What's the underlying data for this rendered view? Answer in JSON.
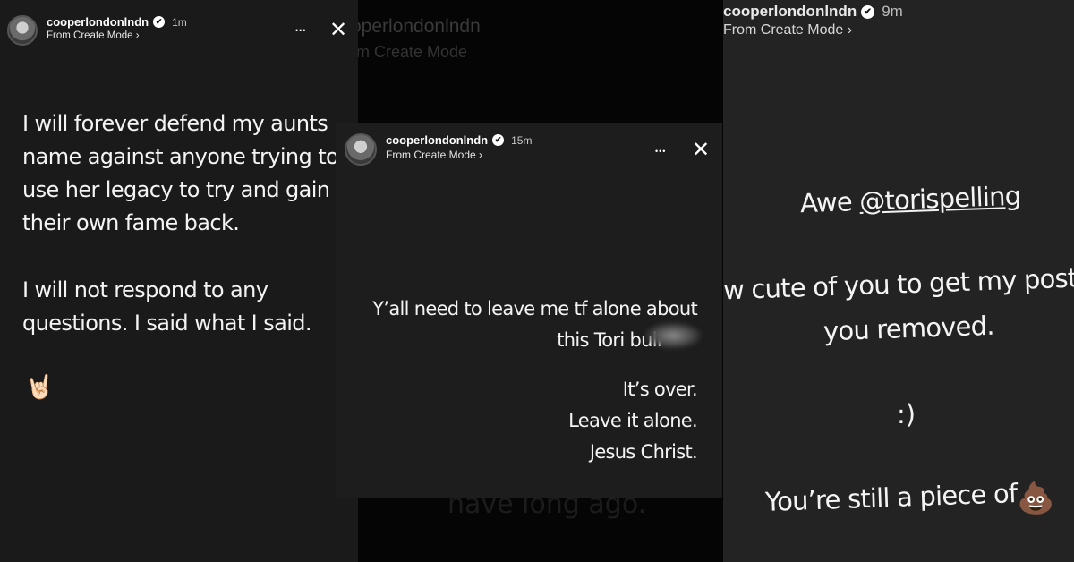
{
  "left_story": {
    "username": "cooperlondonlndn",
    "verified_mark": "✔",
    "time": "1m",
    "subtitle": "From Create Mode ›",
    "more_icon": "•••",
    "close_icon": "✕",
    "paragraph1": [
      "I will forever defend my aunts",
      "name against anyone trying to",
      "use her legacy to try and gain",
      "their own fame back."
    ],
    "paragraph2": [
      "I will not respond to any",
      "questions. I said what I said."
    ],
    "emoji": "🤘🏻"
  },
  "middle_background_story": {
    "header_fragment": "operlondonlndn",
    "subtitle_fragment": "m Create Mode",
    "bottom_fragment": "have long ago."
  },
  "middle_story": {
    "username": "cooperlondonlndn",
    "verified_mark": "✔",
    "time": "15m",
    "subtitle": "From Create Mode ›",
    "more_icon": "•••",
    "close_icon": "✕",
    "line1": "Y’all need to leave me tf alone about",
    "line2": "this Tori bull",
    "line3": "It’s over.",
    "line4": "Leave it alone.",
    "line5": "Jesus Christ."
  },
  "right_story": {
    "username": "cooperlondonlndn",
    "verified_mark": "✔",
    "time": "9m",
    "subtitle": "From Create Mode ›",
    "line1_prefix": "Awe ",
    "line1_mention": "@torispelling",
    "line2": "w cute of you to get my post a",
    "line3": "you removed.",
    "line4": ":)",
    "line5": "You’re still a piece of",
    "emoji": "💩"
  }
}
